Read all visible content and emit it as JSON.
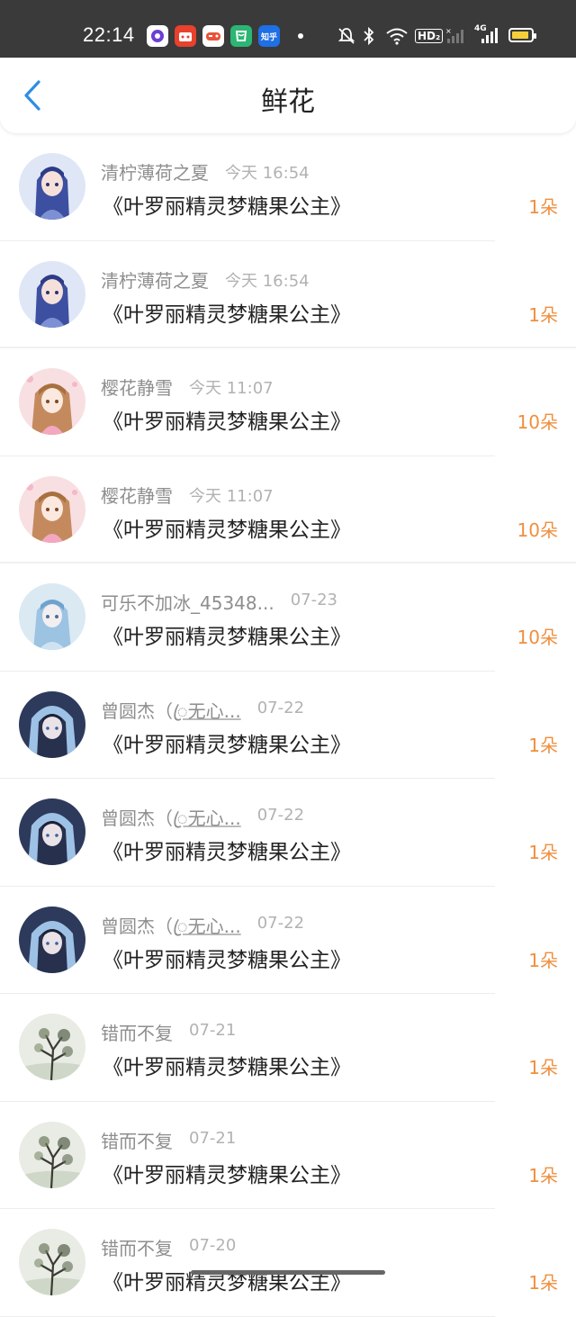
{
  "status_bar": {
    "time": "22:14",
    "app_icons": [
      "music-app-icon",
      "video-app-icon",
      "game-app-icon",
      "shopping-app-icon",
      "zhihu-app-icon"
    ],
    "zhihu_label": "知乎",
    "hd_label": "HD₂",
    "network_label": "4G",
    "battery_color": "#f4cf3a"
  },
  "header": {
    "title": "鲜花",
    "back_icon": "chevron-left-icon",
    "accent_color": "#2f8de4"
  },
  "colors": {
    "count": "#ef8f3e",
    "name": "#8e8e8e",
    "date": "#b2b2b2"
  },
  "rows": [
    {
      "name": "清柠薄荷之夏",
      "name_tail": "",
      "date": "今天 16:54",
      "book": "《叶罗丽精灵梦糖果公主》",
      "count": "1朵",
      "avatar": "anime-avatar-blue-girl"
    },
    {
      "name": "清柠薄荷之夏",
      "name_tail": "",
      "date": "今天 16:54",
      "book": "《叶罗丽精灵梦糖果公主》",
      "count": "1朵",
      "avatar": "anime-avatar-blue-girl"
    },
    {
      "name": "樱花静雪",
      "name_tail": "",
      "date": "今天 11:07",
      "book": "《叶罗丽精灵梦糖果公主》",
      "count": "10朵",
      "avatar": "anime-avatar-pink-girl"
    },
    {
      "name": "樱花静雪",
      "name_tail": "",
      "date": "今天 11:07",
      "book": "《叶罗丽精灵梦糖果公主》",
      "count": "10朵",
      "avatar": "anime-avatar-pink-girl"
    },
    {
      "name": "可乐不加冰_45348...",
      "name_tail": "",
      "date": "07-23",
      "book": "《叶罗丽精灵梦糖果公主》",
      "count": "10朵",
      "avatar": "anime-avatar-light-blue"
    },
    {
      "name": "曾圆杰（",
      "name_tail": "ꦿ无心...",
      "date": "07-22",
      "book": "《叶罗丽精灵梦糖果公主》",
      "count": "1朵",
      "avatar": "anime-avatar-hooded-boy"
    },
    {
      "name": "曾圆杰（",
      "name_tail": "ꦿ无心...",
      "date": "07-22",
      "book": "《叶罗丽精灵梦糖果公主》",
      "count": "1朵",
      "avatar": "anime-avatar-hooded-boy"
    },
    {
      "name": "曾圆杰（",
      "name_tail": "ꦿ无心...",
      "date": "07-22",
      "book": "《叶罗丽精灵梦糖果公主》",
      "count": "1朵",
      "avatar": "anime-avatar-hooded-boy"
    },
    {
      "name": "错而不复",
      "name_tail": "",
      "date": "07-21",
      "book": "《叶罗丽精灵梦糖果公主》",
      "count": "1朵",
      "avatar": "ink-tree-avatar"
    },
    {
      "name": "错而不复",
      "name_tail": "",
      "date": "07-21",
      "book": "《叶罗丽精灵梦糖果公主》",
      "count": "1朵",
      "avatar": "ink-tree-avatar"
    },
    {
      "name": "错而不复",
      "name_tail": "",
      "date": "07-20",
      "book": "《叶罗丽精灵梦糖果公主》",
      "count": "1朵",
      "avatar": "ink-tree-avatar"
    }
  ]
}
